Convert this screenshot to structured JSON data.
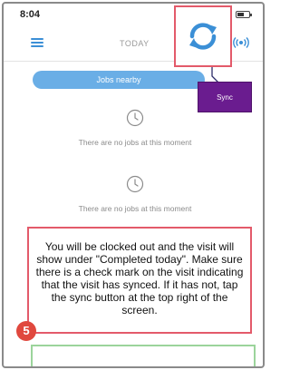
{
  "status_bar": {
    "time": "8:04"
  },
  "header": {
    "title": "TODAY",
    "menu_icon": "hamburger-menu-icon",
    "sync_icon": "sync-icon",
    "broadcast_icon": "broadcast-icon"
  },
  "callout": {
    "sync_label": "Sync"
  },
  "jobs_nearby": {
    "label": "Jobs nearby"
  },
  "empty_states": [
    {
      "icon": "clock-icon",
      "text": "There are no jobs at this moment"
    },
    {
      "icon": "clock-icon",
      "text": "There are no jobs at this moment"
    }
  ],
  "instruction": {
    "text": "You will be clocked out and the visit will show under \"Completed today\". Make sure there is a check mark on the visit indicating that the visit has synced. If it has not, tap the sync button at the top right of the screen."
  },
  "step": {
    "number": "5"
  },
  "colors": {
    "accent_blue": "#3b8fd6",
    "jobs_bar": "#6aaee6",
    "highlight_red": "#e35a6a",
    "tooltip_purple": "#6a1c8f",
    "step_badge": "#e0483e",
    "card_green": "#9bd49b"
  }
}
